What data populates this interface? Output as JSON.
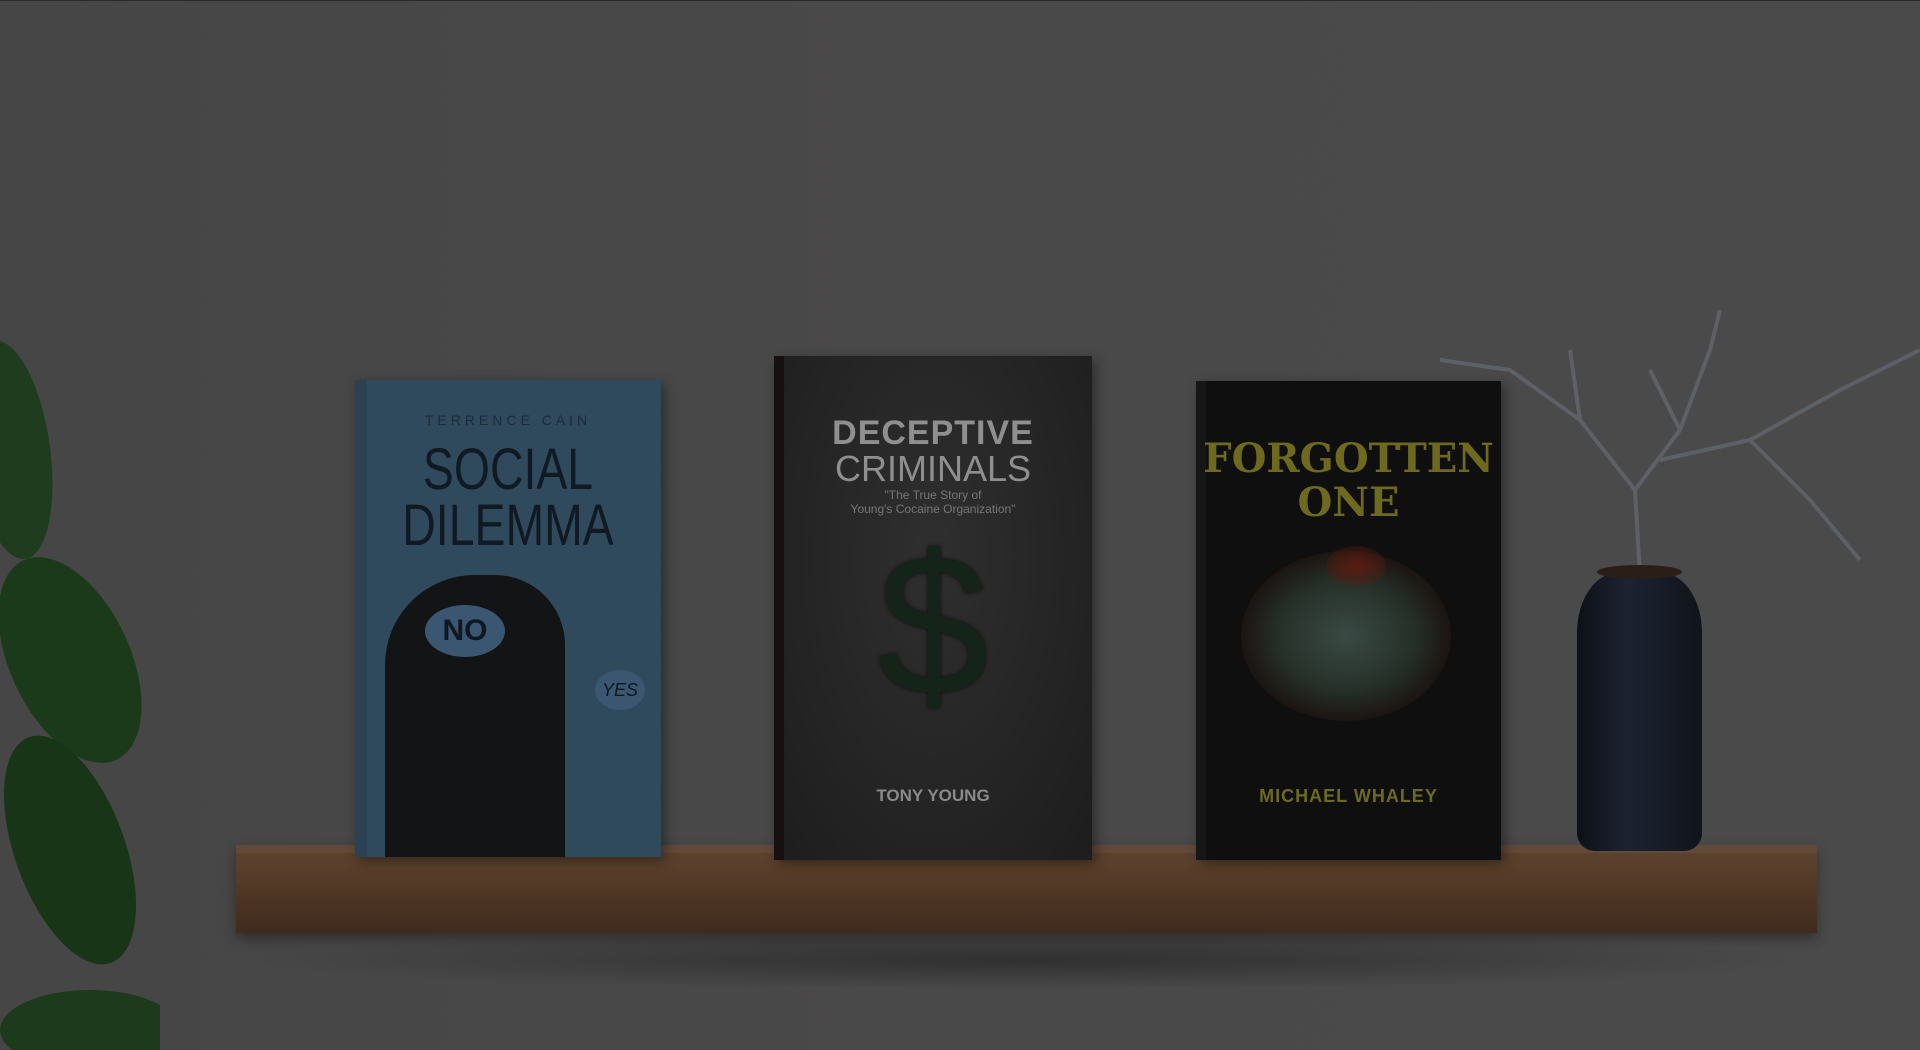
{
  "books": [
    {
      "author": "TERRENCE CAIN",
      "title_line1": "SOCIAL",
      "title_line2": "DILEMMA",
      "bubble_left": "NO",
      "bubble_right": "YES",
      "cover_color": "#2f4a5d"
    },
    {
      "title_line1": "DECEPTIVE",
      "title_line2": "CRIMINALS",
      "subtitle_line1": "\"The True Story of",
      "subtitle_line2": "Young's Cocaine Organization\"",
      "symbol": "$",
      "author": "TONY YOUNG"
    },
    {
      "title_line1": "FORGOTTEN",
      "title_line2": "ONE",
      "author": "MICHAEL WHALEY"
    }
  ],
  "overlay_color": "#000000"
}
